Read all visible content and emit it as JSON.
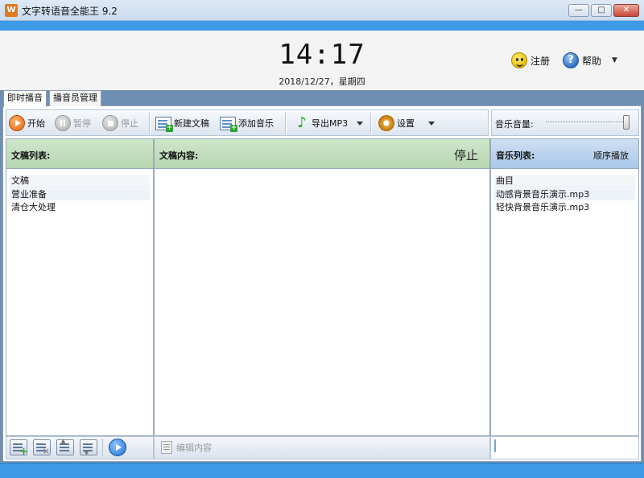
{
  "window": {
    "title": "文字转语音全能王 9.2",
    "app_icon_glyph": "W",
    "minimize": "—",
    "maximize": "□",
    "close": "✕"
  },
  "header": {
    "time": "14:17",
    "date": "2018/12/27，星期四",
    "register_label": "注册",
    "help_label": "帮助",
    "help_glyph": "?",
    "help_dropdown": "▼"
  },
  "tabs": [
    {
      "label": "即时播音",
      "active": true
    },
    {
      "label": "播音员管理",
      "active": false
    }
  ],
  "toolbar": {
    "start_label": "开始",
    "pause_label": "暂停",
    "stop_label": "停止",
    "new_script_label": "新建文稿",
    "add_music_label": "添加音乐",
    "export_label": "导出MP3",
    "settings_label": "设置",
    "music_note_glyph": "♪",
    "volume_label": "音乐音量:",
    "volume_level": 1.0
  },
  "scripts_panel": {
    "title": "文稿列表:",
    "column_header": "文稿",
    "items": [
      "营业准备",
      "清仓大处理"
    ]
  },
  "content_panel": {
    "title": "文稿内容:",
    "status": "停止",
    "edit_label": "编辑内容"
  },
  "music_panel": {
    "title": "音乐列表:",
    "mode": "顺序播放",
    "column_header": "曲目",
    "items": [
      "动感背景音乐演示.mp3",
      "轻快背景音乐演示.mp3"
    ]
  },
  "colors": {
    "accent_blue": "#3c9ae6",
    "panel_green": "#b6d6b0",
    "panel_blue": "#a9c7e8",
    "start_orange": "#e2660f"
  }
}
